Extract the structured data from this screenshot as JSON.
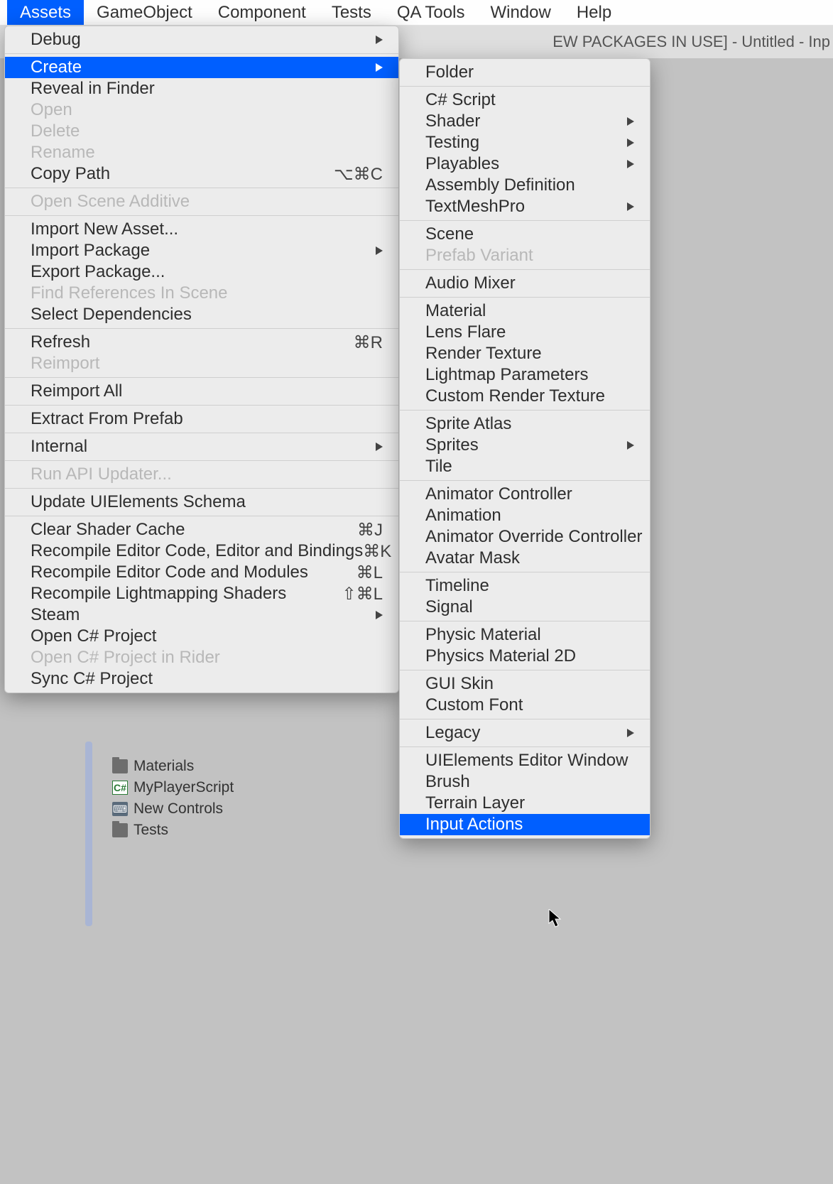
{
  "menubar": {
    "items": [
      "Assets",
      "GameObject",
      "Component",
      "Tests",
      "QA Tools",
      "Window",
      "Help"
    ],
    "selected_index": 0
  },
  "titlebar_fragment": "EW PACKAGES IN USE] - Untitled - Inp",
  "assets_menu": [
    {
      "type": "item",
      "label": "Debug",
      "arrow": true
    },
    {
      "type": "sep"
    },
    {
      "type": "item",
      "label": "Create",
      "arrow": true,
      "highlight": true
    },
    {
      "type": "item",
      "label": "Reveal in Finder"
    },
    {
      "type": "item",
      "label": "Open",
      "disabled": true
    },
    {
      "type": "item",
      "label": "Delete",
      "disabled": true
    },
    {
      "type": "item",
      "label": "Rename",
      "disabled": true
    },
    {
      "type": "item",
      "label": "Copy Path",
      "shortcut": "⌥⌘C"
    },
    {
      "type": "sep"
    },
    {
      "type": "item",
      "label": "Open Scene Additive",
      "disabled": true
    },
    {
      "type": "sep"
    },
    {
      "type": "item",
      "label": "Import New Asset..."
    },
    {
      "type": "item",
      "label": "Import Package",
      "arrow": true
    },
    {
      "type": "item",
      "label": "Export Package..."
    },
    {
      "type": "item",
      "label": "Find References In Scene",
      "disabled": true
    },
    {
      "type": "item",
      "label": "Select Dependencies"
    },
    {
      "type": "sep"
    },
    {
      "type": "item",
      "label": "Refresh",
      "shortcut": "⌘R"
    },
    {
      "type": "item",
      "label": "Reimport",
      "disabled": true
    },
    {
      "type": "sep"
    },
    {
      "type": "item",
      "label": "Reimport All"
    },
    {
      "type": "sep"
    },
    {
      "type": "item",
      "label": "Extract From Prefab"
    },
    {
      "type": "sep"
    },
    {
      "type": "item",
      "label": "Internal",
      "arrow": true
    },
    {
      "type": "sep"
    },
    {
      "type": "item",
      "label": "Run API Updater...",
      "disabled": true
    },
    {
      "type": "sep"
    },
    {
      "type": "item",
      "label": "Update UIElements Schema"
    },
    {
      "type": "sep"
    },
    {
      "type": "item",
      "label": "Clear Shader Cache",
      "shortcut": "⌘J"
    },
    {
      "type": "item",
      "label": "Recompile Editor Code, Editor and Bindings",
      "shortcut": "⌘K"
    },
    {
      "type": "item",
      "label": "Recompile Editor Code and Modules",
      "shortcut": "⌘L"
    },
    {
      "type": "item",
      "label": "Recompile Lightmapping Shaders",
      "shortcut": "⇧⌘L"
    },
    {
      "type": "item",
      "label": "Steam",
      "arrow": true
    },
    {
      "type": "item",
      "label": "Open C# Project"
    },
    {
      "type": "item",
      "label": "Open C# Project in Rider",
      "disabled": true
    },
    {
      "type": "item",
      "label": "Sync C# Project"
    }
  ],
  "create_menu": [
    {
      "type": "item",
      "label": "Folder"
    },
    {
      "type": "sep"
    },
    {
      "type": "item",
      "label": "C# Script"
    },
    {
      "type": "item",
      "label": "Shader",
      "arrow": true
    },
    {
      "type": "item",
      "label": "Testing",
      "arrow": true
    },
    {
      "type": "item",
      "label": "Playables",
      "arrow": true
    },
    {
      "type": "item",
      "label": "Assembly Definition"
    },
    {
      "type": "item",
      "label": "TextMeshPro",
      "arrow": true
    },
    {
      "type": "sep"
    },
    {
      "type": "item",
      "label": "Scene"
    },
    {
      "type": "item",
      "label": "Prefab Variant",
      "disabled": true
    },
    {
      "type": "sep"
    },
    {
      "type": "item",
      "label": "Audio Mixer"
    },
    {
      "type": "sep"
    },
    {
      "type": "item",
      "label": "Material"
    },
    {
      "type": "item",
      "label": "Lens Flare"
    },
    {
      "type": "item",
      "label": "Render Texture"
    },
    {
      "type": "item",
      "label": "Lightmap Parameters"
    },
    {
      "type": "item",
      "label": "Custom Render Texture"
    },
    {
      "type": "sep"
    },
    {
      "type": "item",
      "label": "Sprite Atlas"
    },
    {
      "type": "item",
      "label": "Sprites",
      "arrow": true
    },
    {
      "type": "item",
      "label": "Tile"
    },
    {
      "type": "sep"
    },
    {
      "type": "item",
      "label": "Animator Controller"
    },
    {
      "type": "item",
      "label": "Animation"
    },
    {
      "type": "item",
      "label": "Animator Override Controller"
    },
    {
      "type": "item",
      "label": "Avatar Mask"
    },
    {
      "type": "sep"
    },
    {
      "type": "item",
      "label": "Timeline"
    },
    {
      "type": "item",
      "label": "Signal"
    },
    {
      "type": "sep"
    },
    {
      "type": "item",
      "label": "Physic Material"
    },
    {
      "type": "item",
      "label": "Physics Material 2D"
    },
    {
      "type": "sep"
    },
    {
      "type": "item",
      "label": "GUI Skin"
    },
    {
      "type": "item",
      "label": "Custom Font"
    },
    {
      "type": "sep"
    },
    {
      "type": "item",
      "label": "Legacy",
      "arrow": true
    },
    {
      "type": "sep"
    },
    {
      "type": "item",
      "label": "UIElements Editor Window"
    },
    {
      "type": "item",
      "label": "Brush"
    },
    {
      "type": "item",
      "label": "Terrain Layer"
    },
    {
      "type": "item",
      "label": "Input Actions",
      "highlight": true
    }
  ],
  "project_tree": [
    {
      "icon": "folder",
      "label": "Materials"
    },
    {
      "icon": "cs",
      "label": "MyPlayerScript"
    },
    {
      "icon": "ia",
      "label": "New Controls"
    },
    {
      "icon": "folder",
      "label": "Tests"
    }
  ]
}
